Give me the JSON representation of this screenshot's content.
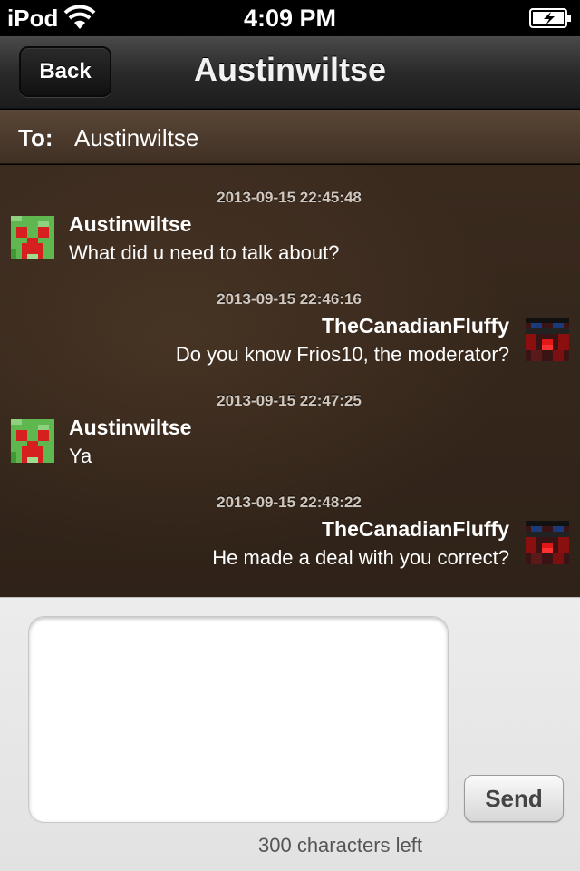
{
  "status_bar": {
    "carrier": "iPod",
    "time": "4:09 PM",
    "wifi_icon": "wifi-icon",
    "battery_icon": "battery-charging-icon"
  },
  "nav": {
    "back_label": "Back",
    "title": "Austinwiltse"
  },
  "to_row": {
    "label": "To:",
    "value": "Austinwiltse"
  },
  "messages": [
    {
      "side": "left",
      "time": "2013-09-15 22:45:48",
      "sender": "Austinwiltse",
      "text": "What did u need to talk about?",
      "avatar": "creeper-avatar"
    },
    {
      "side": "right",
      "time": "2013-09-15 22:46:16",
      "sender": "TheCanadianFluffy",
      "text": "Do you know Frios10, the moderator?",
      "avatar": "dark-pixel-avatar"
    },
    {
      "side": "left",
      "time": "2013-09-15 22:47:25",
      "sender": "Austinwiltse",
      "text": "Ya",
      "avatar": "creeper-avatar"
    },
    {
      "side": "right",
      "time": "2013-09-15 22:48:22",
      "sender": "TheCanadianFluffy",
      "text": "He made a deal with you correct?",
      "avatar": "dark-pixel-avatar"
    }
  ],
  "compose": {
    "input_value": "",
    "send_label": "Send",
    "counter": "300 characters left"
  },
  "colors": {
    "brown_dark": "#2f2218",
    "brown_light": "#5a4636",
    "navbar": "#2a2a2a"
  }
}
